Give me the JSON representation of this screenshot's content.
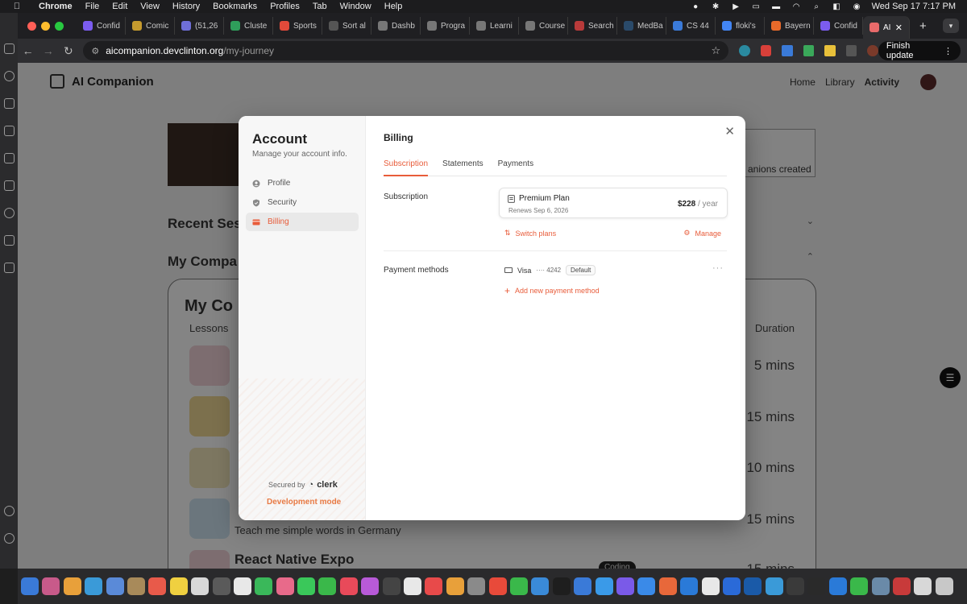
{
  "menubar": {
    "app": "Chrome",
    "items": [
      "File",
      "Edit",
      "View",
      "History",
      "Bookmarks",
      "Profiles",
      "Tab",
      "Window",
      "Help"
    ],
    "datetime": "Wed Sep 17  7:17 PM"
  },
  "tabs": [
    {
      "label": "Confid",
      "color": "#7b5cf0"
    },
    {
      "label": "Comic",
      "color": "#c59a2e"
    },
    {
      "label": "(51,26",
      "color": "#6f6fd8"
    },
    {
      "label": "Cluste",
      "color": "#2f9e5b"
    },
    {
      "label": "Sports",
      "color": "#e24a3a"
    },
    {
      "label": "Sort al",
      "color": "#555555"
    },
    {
      "label": "Dashb",
      "color": "#777777"
    },
    {
      "label": "Progra",
      "color": "#777777"
    },
    {
      "label": "Learni",
      "color": "#777777"
    },
    {
      "label": "Course",
      "color": "#777777"
    },
    {
      "label": "Search",
      "color": "#b83a3a"
    },
    {
      "label": "MedBa",
      "color": "#2a4a6a"
    },
    {
      "label": "CS 44",
      "color": "#3a7ad8"
    },
    {
      "label": "floki's",
      "color": "#4285f4"
    },
    {
      "label": "Bayern",
      "color": "#e86a2a"
    },
    {
      "label": "Confid",
      "color": "#7b5cf0"
    }
  ],
  "active_tab": {
    "label": "AI",
    "color": "#e86a6a"
  },
  "address": {
    "host": "aicompanion.devclinton.org",
    "path": "/my-journey"
  },
  "finish_update_label": "Finish update",
  "page": {
    "brand": "AI Companion",
    "nav": [
      "Home",
      "Library",
      "Activity"
    ],
    "stat_text": "anions created",
    "recent_heading": "Recent Ses",
    "companions_heading": "My Compa",
    "card_title": "My Co",
    "col_lessons": "Lessons",
    "col_duration": "Duration",
    "rows": [
      {
        "duration": "5 mins",
        "icon_color": "#e8c9cf"
      },
      {
        "duration": "15 mins",
        "icon_color": "#e5cf8e"
      },
      {
        "duration": "10 mins",
        "icon_color": "#e8dcb3"
      },
      {
        "duration": "15 mins",
        "icon_color": "#c6dbe8",
        "text": "Teach me simple words in Germany"
      },
      {
        "duration": "15 mins",
        "icon_color": "#e8c9cf",
        "title": "React Native Expo",
        "badge": "Coding"
      }
    ]
  },
  "modal": {
    "title": "Account",
    "subtitle": "Manage your account info.",
    "nav": [
      {
        "label": "Profile",
        "icon": "user-circle-icon"
      },
      {
        "label": "Security",
        "icon": "shield-icon"
      },
      {
        "label": "Billing",
        "icon": "credit-card-icon",
        "active": true
      }
    ],
    "secured_by": "Secured by",
    "secured_brand": "clerk",
    "dev_mode": "Development mode",
    "heading": "Billing",
    "tabs": [
      "Subscription",
      "Statements",
      "Payments"
    ],
    "subscription_label": "Subscription",
    "plan": {
      "name": "Premium Plan",
      "renews": "Renews Sep 6, 2026",
      "price": "$228",
      "period": "/ year"
    },
    "switch_plans": "Switch plans",
    "manage": "Manage",
    "payment_methods_label": "Payment methods",
    "payment_method": {
      "brand": "Visa",
      "last4": "···· 4242",
      "badge": "Default"
    },
    "add_payment": "Add new payment method",
    "accent": "#e85c3a"
  }
}
